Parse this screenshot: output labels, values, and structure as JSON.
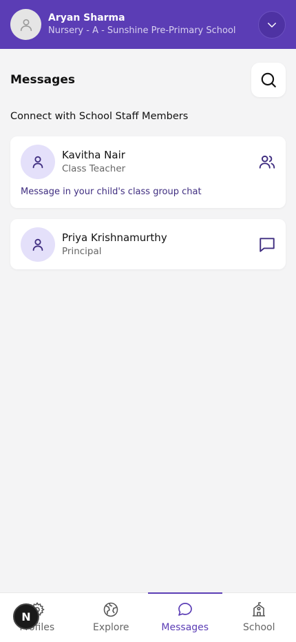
{
  "header": {
    "name": "Aryan Sharma",
    "subtitle": "Nursery - A - Sunshine Pre-Primary School"
  },
  "page": {
    "title": "Messages",
    "section_title": "Connect with School Staff Members"
  },
  "staff": [
    {
      "name": "Kavitha Nair",
      "role": "Class Teacher",
      "action_icon": "group-icon",
      "link": "Message in your child's class group chat"
    },
    {
      "name": "Priya Krishnamurthy",
      "role": "Principal",
      "action_icon": "chat-bubble-icon"
    }
  ],
  "nav": {
    "items": [
      {
        "label": "Profiles",
        "icon": "gear-icon"
      },
      {
        "label": "Explore",
        "icon": "globe-icon"
      },
      {
        "label": "Messages",
        "icon": "chat-bubble-icon",
        "active": true
      },
      {
        "label": "School",
        "icon": "school-icon"
      }
    ]
  },
  "badge": {
    "letter": "N"
  },
  "colors": {
    "primary": "#5b3db5",
    "background": "#f4f4f5",
    "avatar_bg": "#e4e0fa",
    "link_text": "#3f2d80"
  }
}
